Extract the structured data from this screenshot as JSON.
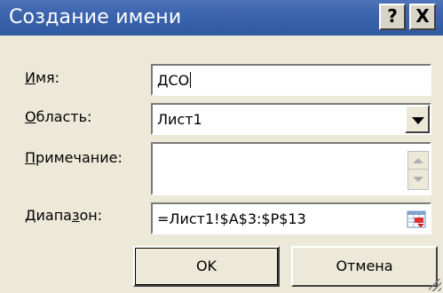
{
  "window": {
    "title": "Создание имени",
    "help_label": "?",
    "close_label": "X",
    "accent_color": "#3f67b0"
  },
  "form": {
    "name": {
      "label_hotkey": "И",
      "label_rest": "мя:",
      "value": "ДСО"
    },
    "scope": {
      "label_hotkey": "О",
      "label_rest": "бласть:",
      "value": "Лист1"
    },
    "comment": {
      "label_hotkey": "П",
      "label_rest": "римечание:",
      "value": ""
    },
    "range": {
      "label_pre": "Диапа",
      "label_hotkey": "з",
      "label_rest": "он:",
      "value": "=Лист1!$A$3:$P$13"
    }
  },
  "buttons": {
    "ok": "OK",
    "cancel": "Отмена"
  },
  "icons": {
    "range_picker": "collapse-dialog-icon",
    "help": "help-icon",
    "close": "close-icon"
  }
}
